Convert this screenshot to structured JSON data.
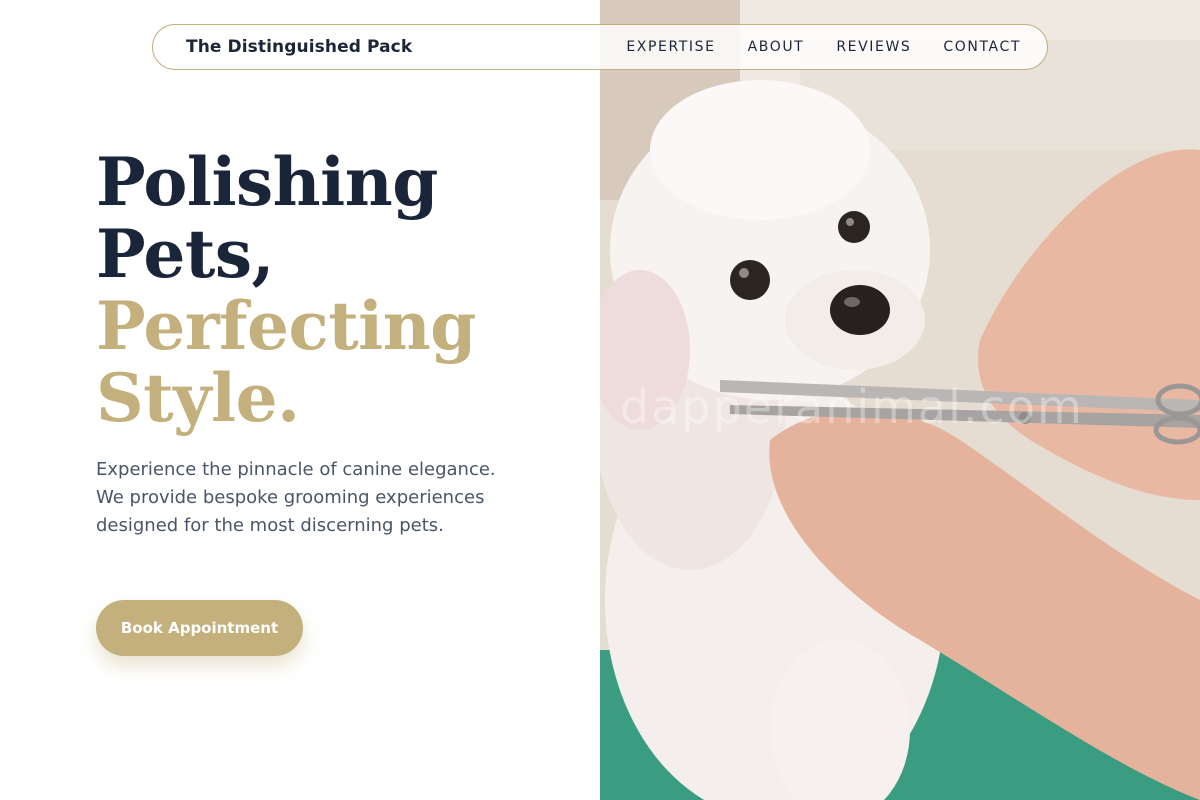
{
  "brand": {
    "name": "The Distinguished Pack"
  },
  "nav": {
    "items": [
      {
        "label": "EXPERTISE"
      },
      {
        "label": "ABOUT"
      },
      {
        "label": "REVIEWS"
      },
      {
        "label": "CONTACT"
      }
    ]
  },
  "hero": {
    "line1": "Polishing",
    "line2": "Pets,",
    "line3": "Perfecting",
    "line4": "Style.",
    "description": "Experience the pinnacle of canine elegance. We provide bespoke grooming experiences designed for the most discerning pets.",
    "cta_label": "Book Appointment"
  },
  "photo": {
    "subject": "white poodle being groomed with scissors",
    "watermark": "dapperanimal.com"
  },
  "colors": {
    "navy": "#1b2539",
    "gold": "#c4b07c",
    "body_text": "#4a5567",
    "background": "#ffffff"
  }
}
